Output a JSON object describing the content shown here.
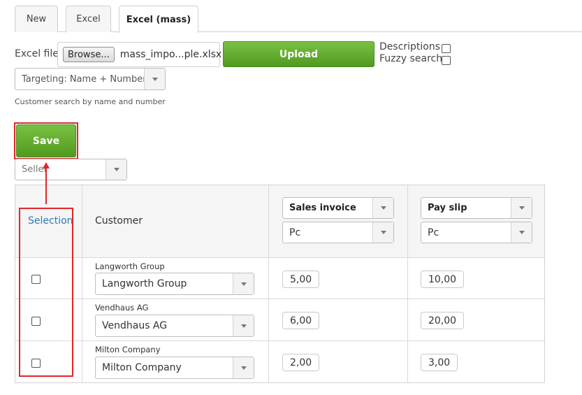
{
  "tabs": [
    {
      "label": "New"
    },
    {
      "label": "Excel"
    },
    {
      "label": "Excel (mass)",
      "active": true
    }
  ],
  "import": {
    "file_label": "Excel file",
    "browse_label": "Browse...",
    "file_name": "mass_impo...ple.xlsx",
    "upload_label": "Upload",
    "descriptions_label": "Descriptions",
    "fuzzy_label": "Fuzzy search",
    "targeting_value": "Targeting: Name + Number",
    "hint": "Customer search by name and number"
  },
  "actions": {
    "save_label": "Save",
    "seller_placeholder": "Seller"
  },
  "table": {
    "selection_header": "Selection",
    "customer_header": "Customer",
    "columns": [
      {
        "type": "Sales invoice",
        "unit": "Pc"
      },
      {
        "type": "Pay slip",
        "unit": "Pc"
      }
    ],
    "rows": [
      {
        "caption": "Langworth Group",
        "customer": "Langworth Group",
        "values": [
          "5,00",
          "10,00"
        ]
      },
      {
        "caption": "Vendhaus AG",
        "customer": "Vendhaus AG",
        "values": [
          "6,00",
          "20,00"
        ]
      },
      {
        "caption": "Milton Company",
        "customer": "Milton Company",
        "values": [
          "2,00",
          "3,00"
        ]
      }
    ]
  },
  "colors": {
    "accent_green": "#5aa82a",
    "annotation_red": "#e0262b",
    "link_blue": "#2a7ab8"
  }
}
